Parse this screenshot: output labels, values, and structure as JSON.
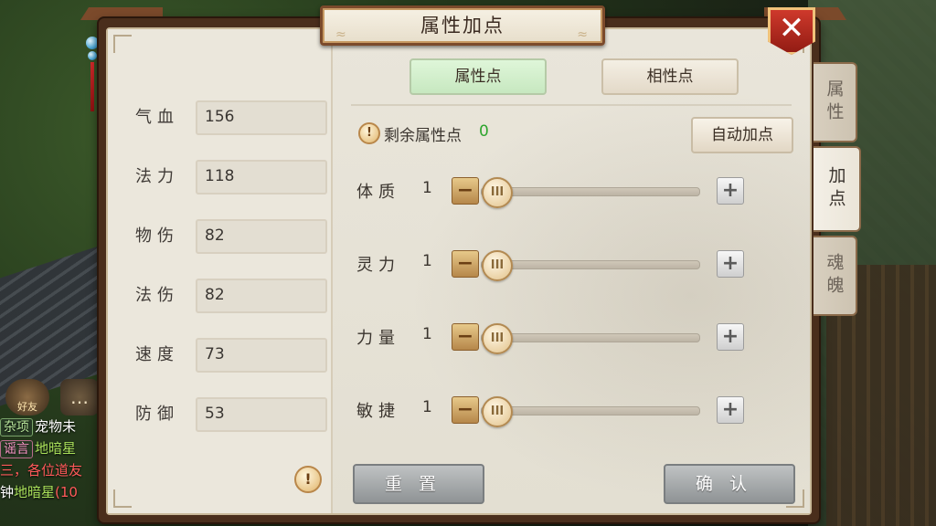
{
  "title": "属性加点",
  "close_icon": "✕",
  "left_stats": [
    {
      "label": "气血",
      "value": "156"
    },
    {
      "label": "法力",
      "value": "118"
    },
    {
      "label": "物伤",
      "value": "82"
    },
    {
      "label": "法伤",
      "value": "82"
    },
    {
      "label": "速度",
      "value": "73"
    },
    {
      "label": "防御",
      "value": "53"
    }
  ],
  "tabs": {
    "attribute_points": "属性点",
    "affinity_points": "相性点"
  },
  "remaining": {
    "label": "剩余属性点",
    "value": "0"
  },
  "auto_assign_label": "自动加点",
  "attributes": [
    {
      "label": "体质",
      "value": "1"
    },
    {
      "label": "灵力",
      "value": "1"
    },
    {
      "label": "力量",
      "value": "1"
    },
    {
      "label": "敏捷",
      "value": "1"
    }
  ],
  "slider_levels": [
    0,
    0,
    0,
    0
  ],
  "buttons": {
    "reset": "重置",
    "confirm": "确认"
  },
  "side_tabs": [
    "属性",
    "加点",
    "魂魄"
  ],
  "chat": {
    "friend_label": "好友",
    "lines": [
      {
        "tag": "杂项",
        "text": "宠物未"
      },
      {
        "tag": "谣言",
        "highlight": "地暗星"
      },
      {
        "text": "三，各位道友"
      },
      {
        "text": "钟",
        "highlight": "地暗星",
        "extra": "(10"
      }
    ]
  },
  "colors": {
    "frame": "#4a2e1c",
    "accent_green": "#2ea52e",
    "close_red": "#d23b2d"
  }
}
